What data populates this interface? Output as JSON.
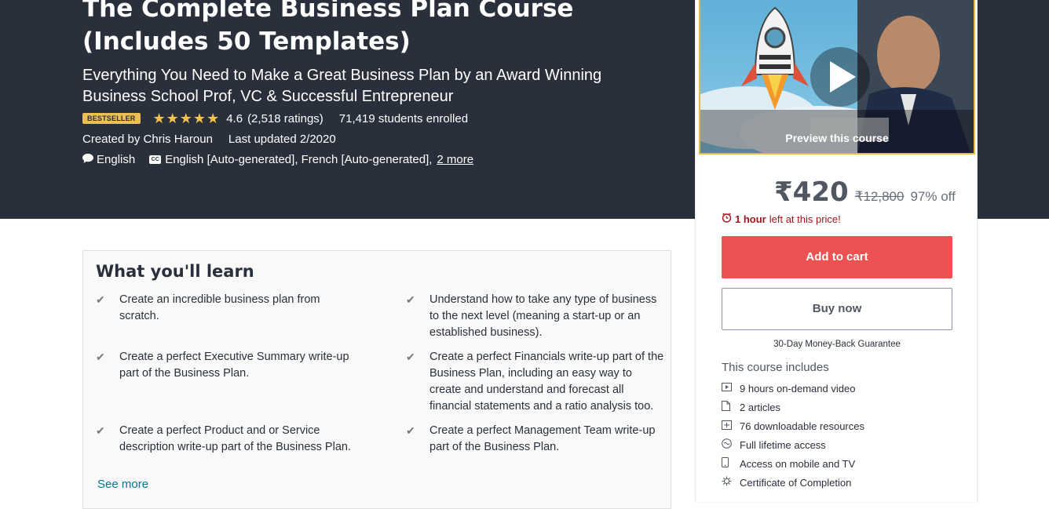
{
  "course": {
    "title_line1": "The Complete Business Plan Course",
    "title_line2": "(Includes 50 Templates)",
    "subtitle": "Everything You Need to Make a Great Business Plan by an Award Winning Business School Prof, VC & Successful Entrepreneur",
    "badge": "BESTSELLER",
    "stars": "★★★★★",
    "rating": "4.6",
    "ratings_count": "(2,518 ratings)",
    "students": "71,419 students enrolled",
    "created_by": "Created by Chris Haroun",
    "last_updated": "Last updated 2/2020",
    "language": "English",
    "captions": "English [Auto-generated], French [Auto-generated],",
    "captions_more": "2 more"
  },
  "learn": {
    "title": "What you'll learn",
    "items_left": [
      "Create an incredible business plan from scratch.",
      "Create a perfect Executive Summary write-up part of the Business Plan.",
      "Create a perfect Product and or Service description write-up part of the Business Plan."
    ],
    "items_right": [
      "Understand how to take any type of business to the next level (meaning a start-up or an established business).",
      "Create a perfect Financials write-up part of the Business Plan, including an easy way to create and understand and forecast all financial statements and a ratio analysis too.",
      "Create a perfect Management Team write-up part of the Business Plan."
    ],
    "see_more": "See more"
  },
  "sidebar": {
    "preview_label": "Preview this course",
    "price": "₹420",
    "original_price": "₹12,800",
    "discount": "97% off",
    "timer_bold": "1 hour",
    "timer_rest": "left at this price!",
    "add_to_cart": "Add to cart",
    "buy_now": "Buy now",
    "guarantee": "30-Day Money-Back Guarantee",
    "includes_title": "This course includes",
    "includes": [
      {
        "icon": "video-icon",
        "text": "9 hours on-demand video"
      },
      {
        "icon": "file-icon",
        "text": "2 articles"
      },
      {
        "icon": "download-icon",
        "text": "76 downloadable resources"
      },
      {
        "icon": "infinity-icon",
        "text": "Full lifetime access"
      },
      {
        "icon": "mobile-icon",
        "text": "Access on mobile and TV"
      },
      {
        "icon": "certificate-icon",
        "text": "Certificate of Completion"
      }
    ]
  },
  "colors": {
    "hero_bg": "#29303b",
    "accent_red": "#ec5252",
    "star": "#f4c150",
    "link": "#007791"
  }
}
